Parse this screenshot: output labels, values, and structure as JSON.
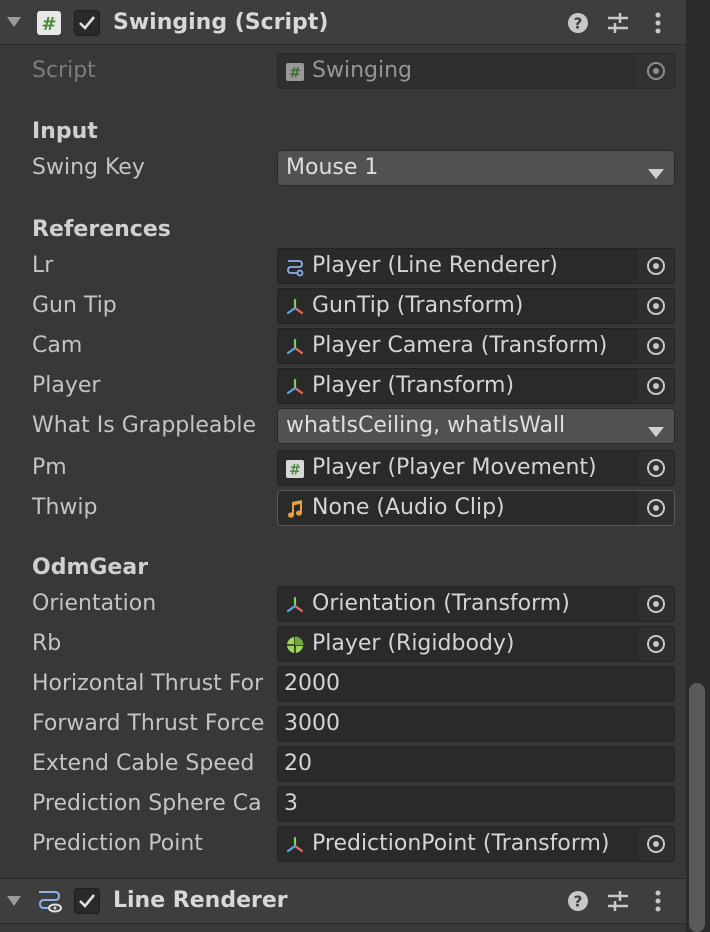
{
  "component": {
    "title": "Swinging (Script)",
    "script_label": "Script",
    "script_value": "Swinging"
  },
  "sections": {
    "input": "Input",
    "references": "References",
    "odmgear": "OdmGear"
  },
  "fields": {
    "swing_key": {
      "label": "Swing Key",
      "value": "Mouse 1"
    },
    "lr": {
      "label": "Lr",
      "value": "Player (Line Renderer)"
    },
    "gun_tip": {
      "label": "Gun Tip",
      "value": "GunTip (Transform)"
    },
    "cam": {
      "label": "Cam",
      "value": "Player Camera (Transform)"
    },
    "player": {
      "label": "Player",
      "value": "Player (Transform)"
    },
    "what_is_grappleable": {
      "label": "What Is Grappleable",
      "value": "whatIsCeiling, whatIsWall"
    },
    "pm": {
      "label": "Pm",
      "value": "Player (Player Movement)"
    },
    "thwip": {
      "label": "Thwip",
      "value": "None (Audio Clip)"
    },
    "orientation": {
      "label": "Orientation",
      "value": "Orientation (Transform)"
    },
    "rb": {
      "label": "Rb",
      "value": "Player (Rigidbody)"
    },
    "horizontal_thrust": {
      "label": "Horizontal Thrust For",
      "value": "2000"
    },
    "forward_thrust": {
      "label": "Forward Thrust Force",
      "value": "3000"
    },
    "extend_cable_speed": {
      "label": "Extend Cable Speed",
      "value": "20"
    },
    "prediction_sphere": {
      "label": "Prediction Sphere Ca",
      "value": "3"
    },
    "prediction_point": {
      "label": "Prediction Point",
      "value": "PredictionPoint (Transform)"
    }
  },
  "next_component": {
    "title": "Line Renderer"
  },
  "colors": {
    "background": "#383838",
    "header": "#3e3e3e",
    "field": "#2a2a2a",
    "dropdown": "#515151",
    "transform_icon_red": "#e86a5a",
    "transform_icon_green": "#7ccf5a",
    "transform_icon_blue": "#5aa5e8",
    "audio_icon": "#e8a23a",
    "rigidbody_icon": "#9fd45a"
  }
}
